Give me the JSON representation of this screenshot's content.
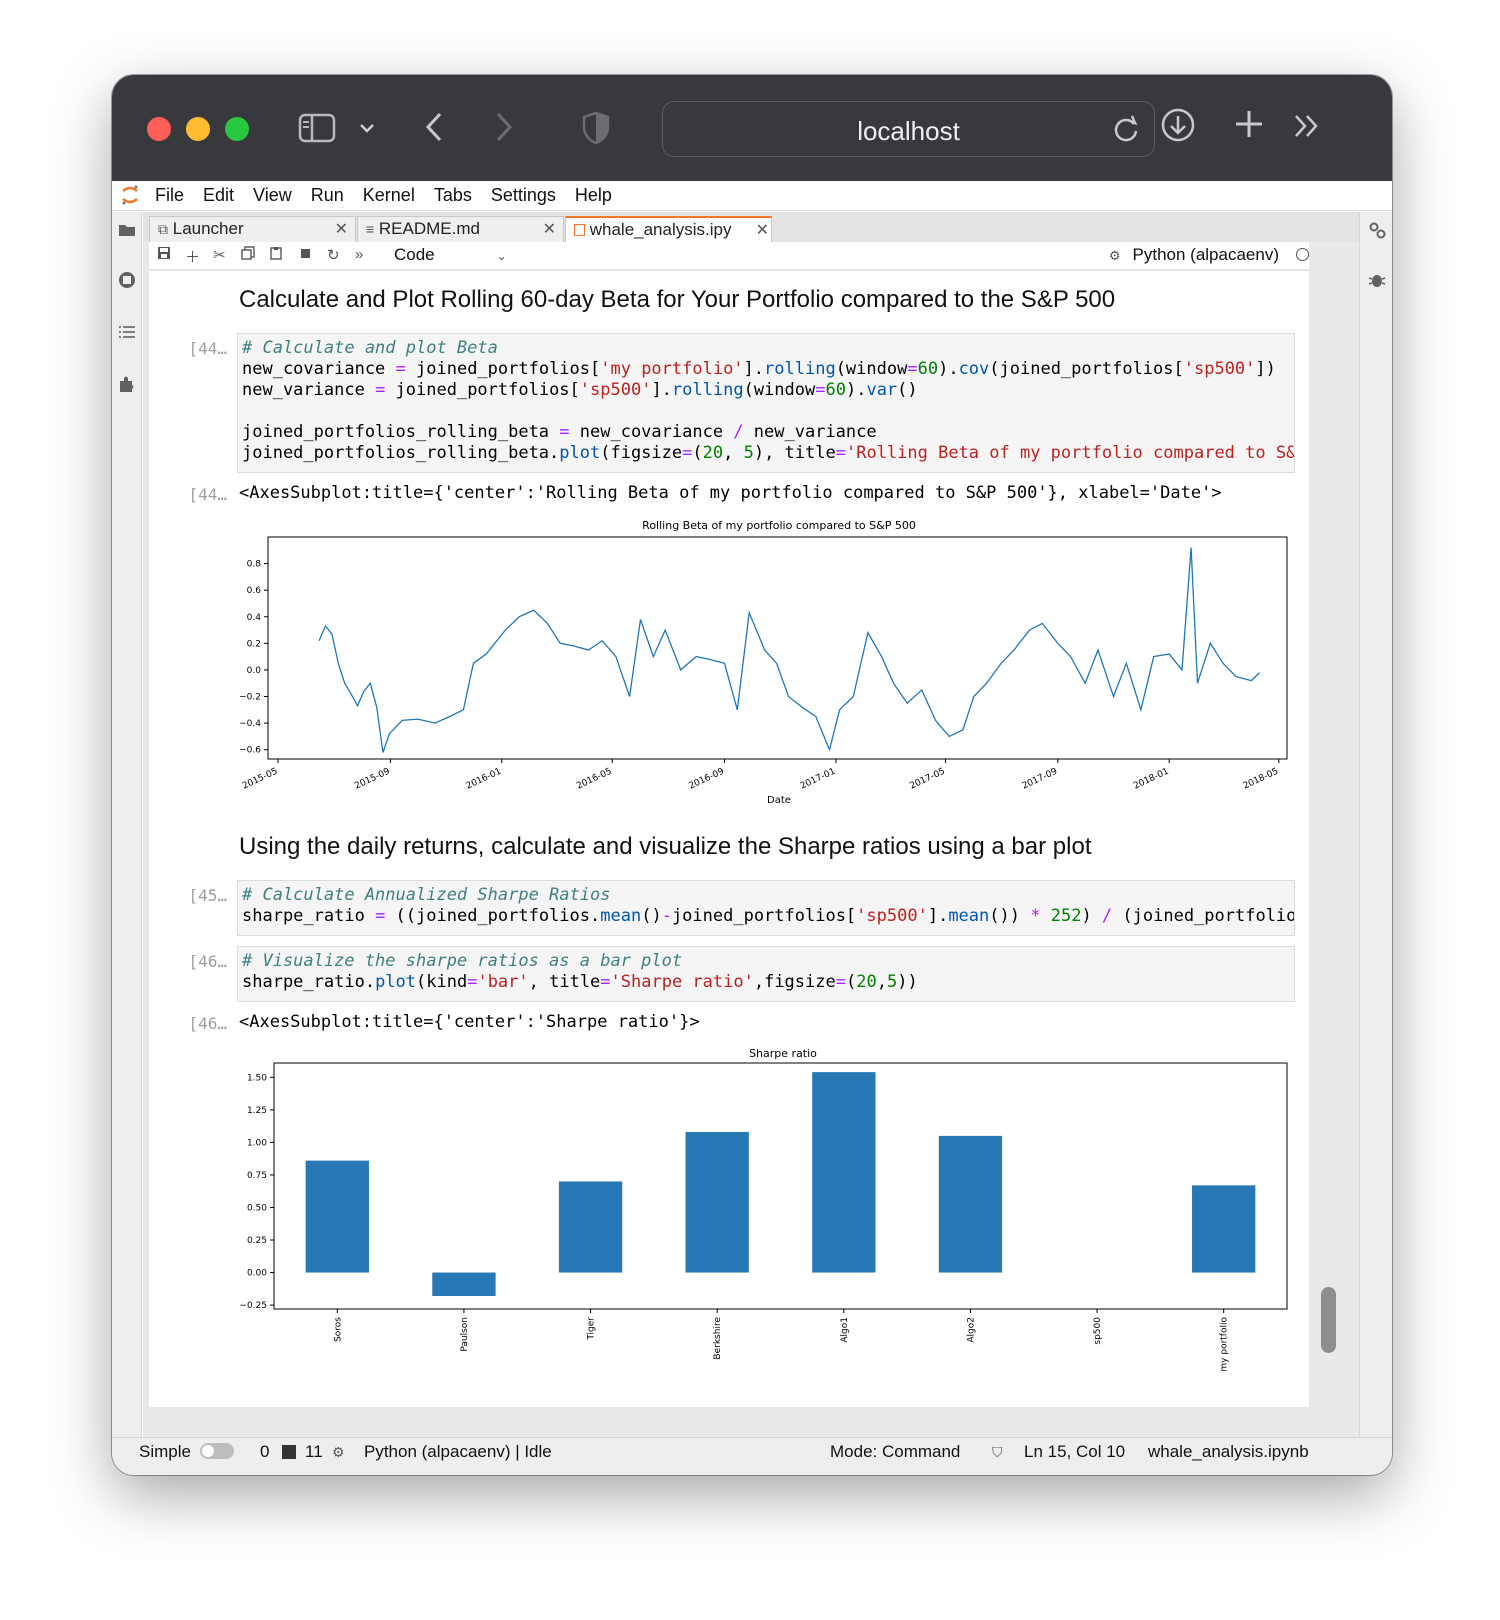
{
  "browser": {
    "url": "localhost"
  },
  "menu": [
    "File",
    "Edit",
    "View",
    "Run",
    "Kernel",
    "Tabs",
    "Settings",
    "Help"
  ],
  "tabs": [
    {
      "label": "Launcher",
      "active": false
    },
    {
      "label": "README.md",
      "active": false
    },
    {
      "label": "whale_analysis.ipy",
      "active": true
    }
  ],
  "toolbar": {
    "cell_type": "Code",
    "kernel": "Python (alpacaenv)"
  },
  "cells": {
    "md1": "Calculate and Plot Rolling 60-day Beta for Your Portfolio compared to the S&P 500",
    "p1_in": "[44…",
    "p1_out": "[44…",
    "out1": "<AxesSubplot:title={'center':'Rolling Beta of my portfolio compared to S&P 500'}, xlabel='Date'>",
    "md2": "Using the daily returns, calculate and visualize the Sharpe ratios using a bar plot",
    "p2_in": "[45…",
    "p3_in": "[46…",
    "p3_out": "[46…",
    "out2": "<AxesSubplot:title={'center':'Sharpe ratio'}>"
  },
  "status": {
    "mode_label": "Simple",
    "count_a": "0",
    "count_b": "11",
    "kernel_state": "Python (alpacaenv) | Idle",
    "mode": "Mode: Command",
    "position": "Ln 15, Col 10",
    "filename": "whale_analysis.ipynb"
  },
  "colors": {
    "accent": "#f37726",
    "series": "#1f77b4",
    "bar": "#2878b5"
  },
  "chart_data": [
    {
      "type": "line",
      "title": "Rolling Beta of my portfolio compared to S&P 500",
      "xlabel": "Date",
      "ylabel": "",
      "xticks": [
        "2015-05",
        "2015-09",
        "2016-01",
        "2016-05",
        "2016-09",
        "2017-01",
        "2017-05",
        "2017-09",
        "2018-01",
        "2018-05"
      ],
      "yticks": [
        "0.8",
        "0.6",
        "0.4",
        "0.2",
        "0.0",
        "−0.2",
        "−0.4",
        "−0.6"
      ],
      "ylim": [
        -0.67,
        1.0
      ],
      "xlim": [
        "2015-04-20",
        "2018-05-10"
      ],
      "series": [
        {
          "values": [
            [
              "2015-06-15",
              0.22
            ],
            [
              "2015-06-22",
              0.33
            ],
            [
              "2015-06-29",
              0.27
            ],
            [
              "2015-07-06",
              0.05
            ],
            [
              "2015-07-13",
              -0.1
            ],
            [
              "2015-07-20",
              -0.18
            ],
            [
              "2015-07-27",
              -0.27
            ],
            [
              "2015-08-03",
              -0.16
            ],
            [
              "2015-08-10",
              -0.1
            ],
            [
              "2015-08-17",
              -0.28
            ],
            [
              "2015-08-24",
              -0.62
            ],
            [
              "2015-08-31",
              -0.48
            ],
            [
              "2015-09-14",
              -0.38
            ],
            [
              "2015-10-01",
              -0.37
            ],
            [
              "2015-10-20",
              -0.4
            ],
            [
              "2015-11-05",
              -0.35
            ],
            [
              "2015-11-20",
              -0.3
            ],
            [
              "2015-12-01",
              0.05
            ],
            [
              "2015-12-15",
              0.12
            ],
            [
              "2016-01-05",
              0.3
            ],
            [
              "2016-01-20",
              0.4
            ],
            [
              "2016-02-05",
              0.45
            ],
            [
              "2016-02-20",
              0.35
            ],
            [
              "2016-03-05",
              0.2
            ],
            [
              "2016-03-20",
              0.18
            ],
            [
              "2016-04-05",
              0.15
            ],
            [
              "2016-04-20",
              0.22
            ],
            [
              "2016-05-05",
              0.1
            ],
            [
              "2016-05-20",
              -0.2
            ],
            [
              "2016-06-01",
              0.38
            ],
            [
              "2016-06-15",
              0.1
            ],
            [
              "2016-06-28",
              0.3
            ],
            [
              "2016-07-15",
              0.0
            ],
            [
              "2016-08-01",
              0.1
            ],
            [
              "2016-08-15",
              0.08
            ],
            [
              "2016-09-01",
              0.05
            ],
            [
              "2016-09-15",
              -0.3
            ],
            [
              "2016-09-28",
              0.43
            ],
            [
              "2016-10-15",
              0.15
            ],
            [
              "2016-10-28",
              0.05
            ],
            [
              "2016-11-10",
              -0.2
            ],
            [
              "2016-11-25",
              -0.28
            ],
            [
              "2016-12-10",
              -0.35
            ],
            [
              "2016-12-25",
              -0.6
            ],
            [
              "2017-01-05",
              -0.3
            ],
            [
              "2017-01-20",
              -0.2
            ],
            [
              "2017-02-05",
              0.28
            ],
            [
              "2017-02-20",
              0.1
            ],
            [
              "2017-03-05",
              -0.1
            ],
            [
              "2017-03-20",
              -0.25
            ],
            [
              "2017-04-05",
              -0.15
            ],
            [
              "2017-04-20",
              -0.38
            ],
            [
              "2017-05-05",
              -0.5
            ],
            [
              "2017-05-20",
              -0.45
            ],
            [
              "2017-06-01",
              -0.2
            ],
            [
              "2017-06-15",
              -0.1
            ],
            [
              "2017-07-01",
              0.05
            ],
            [
              "2017-07-15",
              0.15
            ],
            [
              "2017-08-01",
              0.3
            ],
            [
              "2017-08-15",
              0.35
            ],
            [
              "2017-09-01",
              0.2
            ],
            [
              "2017-09-15",
              0.1
            ],
            [
              "2017-10-01",
              -0.1
            ],
            [
              "2017-10-15",
              0.15
            ],
            [
              "2017-11-01",
              -0.2
            ],
            [
              "2017-11-15",
              0.05
            ],
            [
              "2017-12-01",
              -0.3
            ],
            [
              "2017-12-15",
              0.1
            ],
            [
              "2018-01-01",
              0.12
            ],
            [
              "2018-01-15",
              0.0
            ],
            [
              "2018-01-25",
              0.92
            ],
            [
              "2018-02-01",
              -0.1
            ],
            [
              "2018-02-15",
              0.2
            ],
            [
              "2018-03-01",
              0.05
            ],
            [
              "2018-03-15",
              -0.05
            ],
            [
              "2018-04-01",
              -0.08
            ],
            [
              "2018-04-10",
              -0.02
            ]
          ]
        }
      ]
    },
    {
      "type": "bar",
      "title": "Sharpe ratio",
      "categories": [
        "Soros",
        "Paulson",
        "Tiger",
        "Berkshire",
        "Algo1",
        "Algo2",
        "sp500",
        "my portfolio"
      ],
      "values": [
        0.86,
        -0.18,
        0.7,
        1.08,
        1.54,
        1.05,
        0.0,
        0.67
      ],
      "yticks": [
        "1.50",
        "1.25",
        "1.00",
        "0.75",
        "0.50",
        "0.25",
        "0.00",
        "−0.25"
      ],
      "ylim": [
        -0.28,
        1.61
      ],
      "xlabel": "",
      "ylabel": ""
    }
  ]
}
